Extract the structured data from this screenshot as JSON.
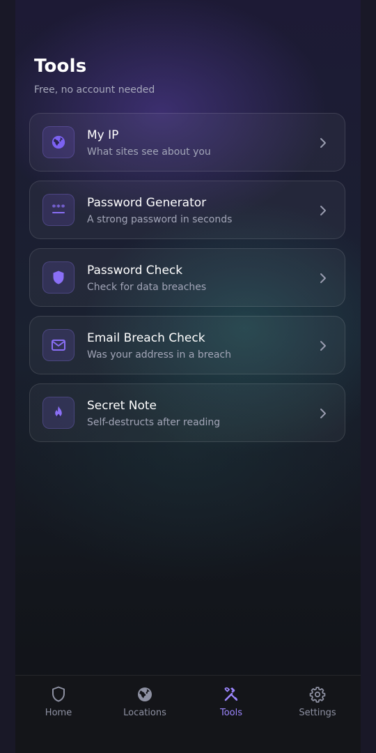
{
  "header": {
    "title": "Tools",
    "subtitle": "Free, no account needed"
  },
  "tools": [
    {
      "name": "My IP",
      "description": "What sites see about you",
      "icon": "globe-icon"
    },
    {
      "name": "Password Generator",
      "description": "A strong password in seconds",
      "icon": "password-asterisks-icon"
    },
    {
      "name": "Password Check",
      "description": "Check for data breaches",
      "icon": "shield-icon"
    },
    {
      "name": "Email Breach Check",
      "description": "Was your address in a breach",
      "icon": "mail-icon"
    },
    {
      "name": "Secret Note",
      "description": "Self-destructs after reading",
      "icon": "flame-icon"
    }
  ],
  "bottom_nav": {
    "items": [
      {
        "label": "Home",
        "icon": "shield-icon",
        "active": false
      },
      {
        "label": "Locations",
        "icon": "globe-icon",
        "active": false
      },
      {
        "label": "Tools",
        "icon": "tools-icon",
        "active": true
      },
      {
        "label": "Settings",
        "icon": "gear-icon",
        "active": false
      }
    ]
  },
  "colors": {
    "accent": "#8b6cf6",
    "active_nav": "#9d87ff",
    "inactive_nav": "#8e91a2",
    "secondary_text": "#a3a6b8"
  }
}
